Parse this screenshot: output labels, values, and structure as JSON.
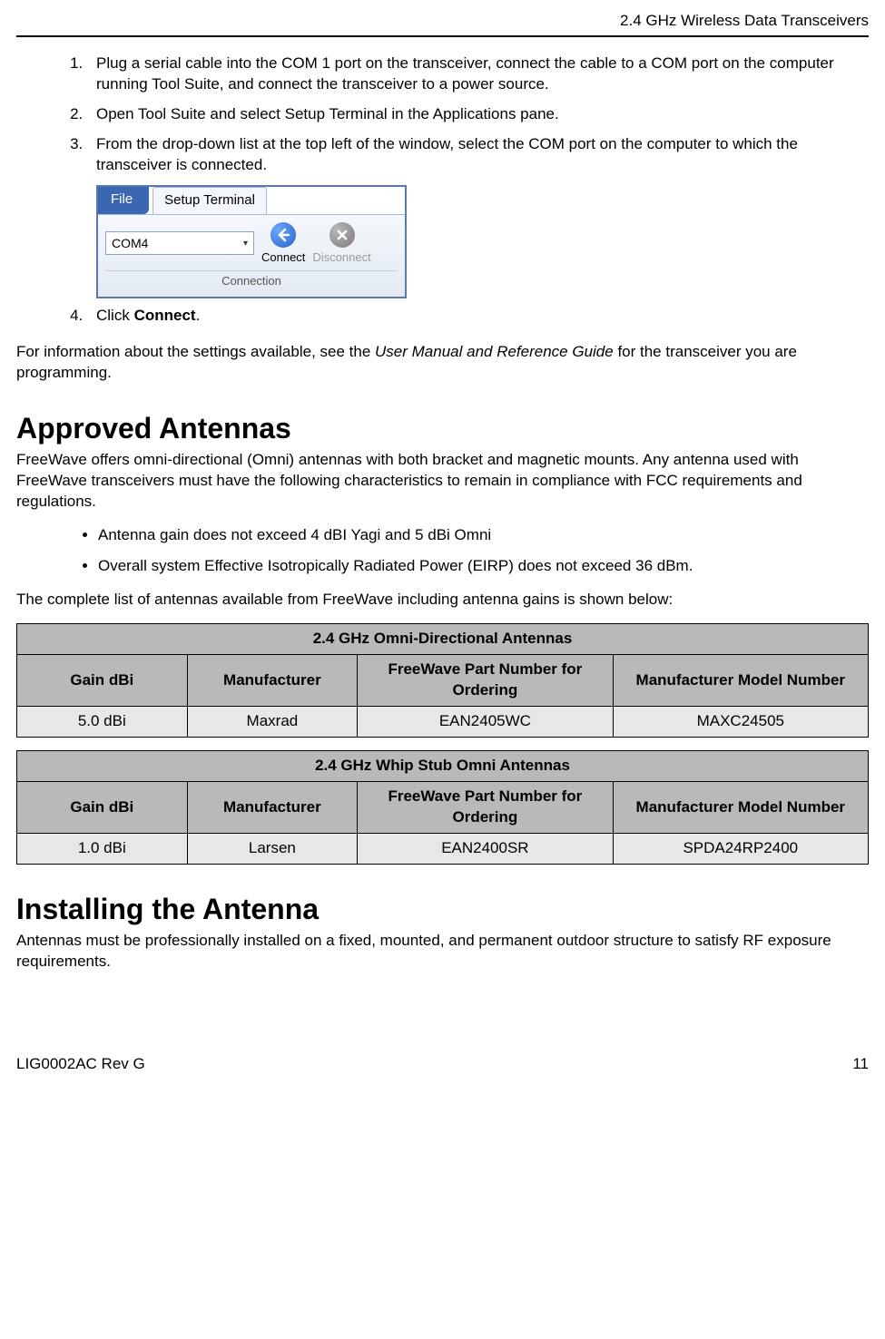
{
  "header": {
    "right": "2.4 GHz Wireless Data Transceivers"
  },
  "steps": [
    "Plug a serial cable into the COM 1 port on the transceiver, connect the cable to a COM port on the computer running Tool Suite, and connect the transceiver to a power source.",
    "Open Tool Suite and select Setup Terminal in the Applications pane.",
    "From the drop-down list at the top left of the window, select the COM port on the computer to which the transceiver is connected."
  ],
  "app": {
    "file_label": "File",
    "tab_label": "Setup Terminal",
    "combo_value": "COM4",
    "connect_label": "Connect",
    "disconnect_label": "Disconnect",
    "group_label": "Connection"
  },
  "step4_prefix": "Click ",
  "step4_bold": "Connect",
  "step4_suffix": ".",
  "note_prefix": "For information about the settings available, see the ",
  "note_italic": "User Manual and Reference Guide",
  "note_suffix": " for the transceiver you are programming.",
  "h1_approved": "Approved Antennas",
  "approved_intro": "FreeWave offers omni-directional (Omni) antennas with both bracket and magnetic mounts. Any antenna used with FreeWave transceivers must have the following characteristics to remain in compliance with FCC requirements and regulations.",
  "bullets": [
    "Antenna gain does not exceed 4 dBI Yagi and 5 dBi Omni",
    "Overall system Effective Isotropically Radiated Power (EIRP) does not exceed 36 dBm."
  ],
  "list_intro": "The complete list of antennas available from FreeWave including antenna gains is shown below:",
  "table1": {
    "title": "2.4 GHz Omni-Directional Antennas",
    "headers": [
      "Gain dBi",
      "Manufacturer",
      "FreeWave Part Number for Ordering",
      "Manufacturer Model Number"
    ],
    "row": [
      "5.0 dBi",
      "Maxrad",
      "EAN2405WC",
      "MAXC24505"
    ]
  },
  "table2": {
    "title": "2.4 GHz Whip Stub Omni Antennas",
    "headers": [
      "Gain dBi",
      "Manufacturer",
      "FreeWave Part Number for Ordering",
      "Manufacturer Model Number"
    ],
    "row": [
      "1.0 dBi",
      "Larsen",
      "EAN2400SR",
      "SPDA24RP2400"
    ]
  },
  "h1_installing": "Installing the Antenna",
  "installing_text": "Antennas must be professionally installed on a fixed, mounted, and permanent outdoor structure to satisfy RF exposure requirements.",
  "footer": {
    "left": "LIG0002AC Rev G",
    "right": "11"
  }
}
